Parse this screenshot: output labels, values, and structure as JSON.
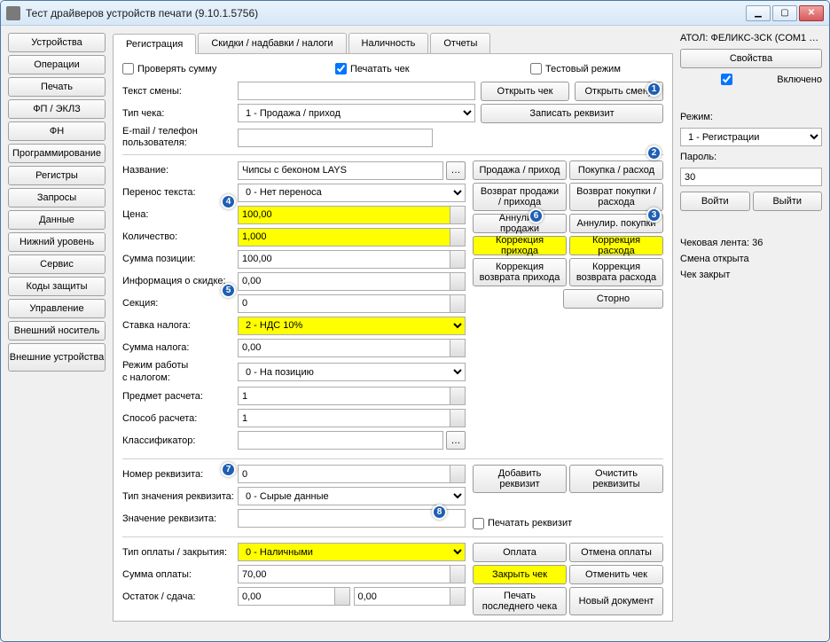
{
  "window_title": "Тест драйверов устройств печати (9.10.1.5756)",
  "nav": [
    "Устройства",
    "Операции",
    "Печать",
    "ФП / ЭКЛЗ",
    "ФН",
    "Программирование",
    "Регистры",
    "Запросы",
    "Данные",
    "Нижний уровень",
    "Сервис",
    "Коды защиты",
    "Управление",
    "Внешний носитель",
    "Внешние устройства"
  ],
  "tabs": [
    "Регистрация",
    "Скидки / надбавки / налоги",
    "Наличность",
    "Отчеты"
  ],
  "checks": {
    "verify_sum": "Проверять сумму",
    "print_receipt": "Печатать чек",
    "test_mode": "Тестовый режим"
  },
  "labels": {
    "shift_text": "Текст смены:",
    "receipt_type": "Тип чека:",
    "user_contact1": "E-mail / телефон",
    "user_contact2": "пользователя:",
    "name": "Название:",
    "text_wrap": "Перенос текста:",
    "price": "Цена:",
    "qty": "Количество:",
    "pos_sum": "Сумма позиции:",
    "discount_info": "Информация о скидке:",
    "section": "Секция:",
    "tax_rate": "Ставка налога:",
    "tax_sum": "Сумма налога:",
    "tax_mode1": "Режим работы",
    "tax_mode2": "с налогом:",
    "calc_subject": "Предмет расчета:",
    "calc_method": "Способ расчета:",
    "classifier": "Классификатор:",
    "req_num": "Номер реквизита:",
    "req_val_type": "Тип значения реквизита:",
    "req_val": "Значение реквизита:",
    "pay_close_type": "Тип оплаты / закрытия:",
    "pay_sum": "Сумма оплаты:",
    "remainder": "Остаток / сдача:"
  },
  "values": {
    "shift_text": "",
    "receipt_type": "1 - Продажа / приход",
    "user_contact": "",
    "name": "Чипсы с беконом LAYS",
    "text_wrap": "0 - Нет переноса",
    "price": "100,00",
    "qty": "1,000",
    "pos_sum": "100,00",
    "discount_info": "0,00",
    "section": "0",
    "tax_rate": "2 - НДС 10%",
    "tax_sum": "0,00",
    "tax_mode": "0 - На позицию",
    "calc_subject": "1",
    "calc_method": "1",
    "classifier": "",
    "req_num": "0",
    "req_val_type": "0 - Сырые данные",
    "req_val": "",
    "pay_close_type": "0 - Наличными",
    "pay_sum": "70,00",
    "remainder1": "0,00",
    "remainder2": "0,00"
  },
  "buttons": {
    "open_receipt": "Открыть чек",
    "open_shift": "Открыть смену",
    "write_req": "Записать реквизит",
    "sale_income": "Продажа / приход",
    "buy_expense": "Покупка / расход",
    "return_sale": "Возврат продажи / прихода",
    "return_buy": "Возврат покупки / расхода",
    "annul_sale": "Аннулир. продажи",
    "annul_buy": "Аннулир. покупки",
    "corr_income": "Коррекция прихода",
    "corr_expense": "Коррекция расхода",
    "corr_ret_income": "Коррекция возврата прихода",
    "corr_ret_expense": "Коррекция возврата расхода",
    "storno": "Сторно",
    "add_req": "Добавить реквизит",
    "clear_req": "Очистить реквизиты",
    "print_req": "Печатать реквизит",
    "payment": "Оплата",
    "cancel_payment": "Отмена оплаты",
    "close_receipt": "Закрыть чек",
    "cancel_receipt": "Отменить чек",
    "print_last": "Печать последнего чека",
    "new_doc": "Новый документ"
  },
  "right": {
    "device": "АТОЛ: ФЕЛИКС-3СК (COM1 …",
    "properties": "Свойства",
    "enabled": "Включено",
    "mode_lbl": "Режим:",
    "mode": "1 - Регистрации",
    "password_lbl": "Пароль:",
    "password": "30",
    "login": "Войти",
    "logout": "Выйти",
    "tape": "Чековая лента: 36",
    "shift": "Смена открыта",
    "receipt_state": "Чек закрыт"
  },
  "markers": {
    "1": "1",
    "2": "2",
    "3": "3",
    "4": "4",
    "5": "5",
    "6": "6",
    "7": "7",
    "8": "8"
  }
}
